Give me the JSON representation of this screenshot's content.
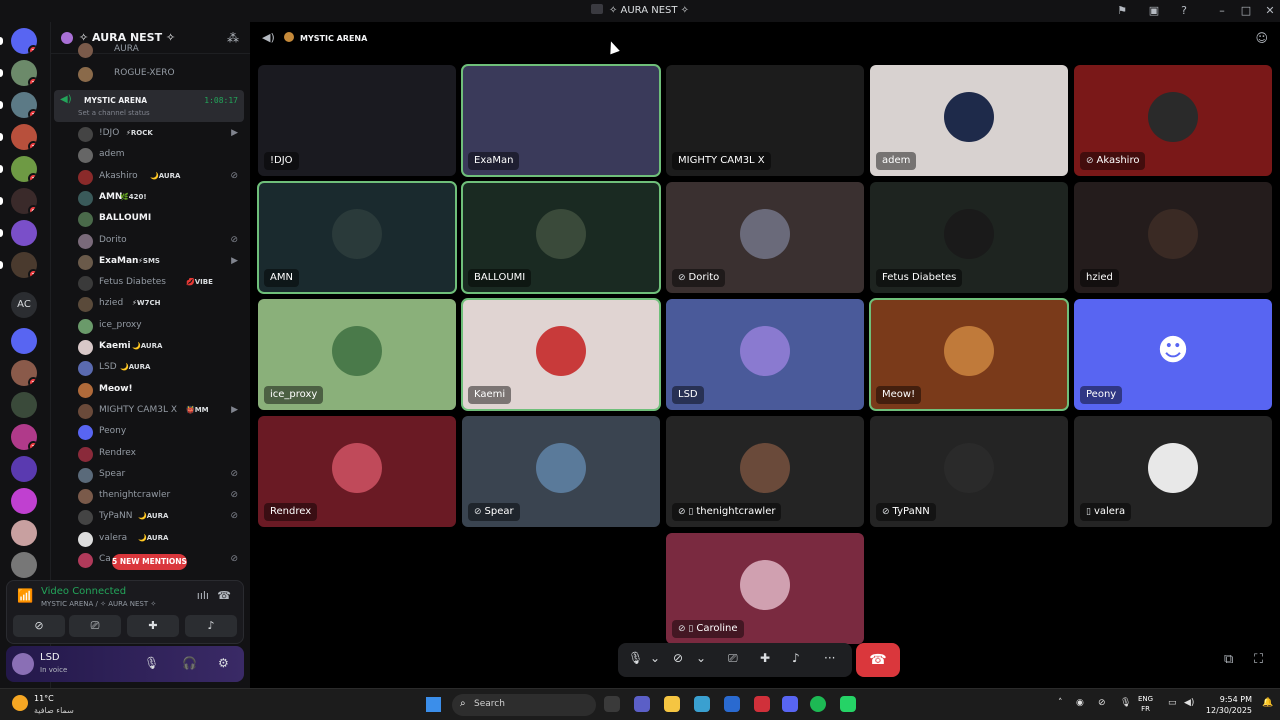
{
  "window": {
    "title": "✧ AURA NEST ✧"
  },
  "server": {
    "name": "✧ AURA NEST ✧"
  },
  "guilds": [
    {
      "badge": "2",
      "color": "#5865f2"
    },
    {
      "badge": "1",
      "color": "#6c8a6a"
    },
    {
      "badge": "1",
      "color": "#5c7a86"
    },
    {
      "badge": "1",
      "color": "#b8503c"
    },
    {
      "badge": "1",
      "color": "#6e9a44"
    },
    {
      "badge": "6",
      "color": "#3a2a2a"
    },
    {
      "badge": "",
      "color": "#7a4fc9"
    },
    {
      "badge": "1",
      "color": "#4a3a2e"
    },
    {
      "label": "AC",
      "color": "#2b2d31"
    },
    {
      "badge": "",
      "color": "#5865f2"
    },
    {
      "badge": "3",
      "color": "#8a5a4a"
    },
    {
      "badge": "",
      "color": "#3a4a3a"
    },
    {
      "badge": "3",
      "color": "#b03a8a"
    },
    {
      "badge": "",
      "color": "#5a3ab0"
    },
    {
      "badge": "",
      "color": "#c040d0"
    },
    {
      "badge": "",
      "color": "#c8a0a0"
    },
    {
      "badge": "",
      "color": "#777777"
    }
  ],
  "sidebar_top": [
    {
      "name": "AURA",
      "color": "#7a5a4a"
    },
    {
      "name": "ROGUE-XERO",
      "color": "#8a6a4a"
    }
  ],
  "channel": {
    "name": "MYSTIC ARENA",
    "timer": "1:08:17",
    "status": "Set a channel status"
  },
  "members": [
    {
      "name": "!DJO",
      "tag": "⚡ROCK",
      "bold": false,
      "color": "#444",
      "icon": "▶"
    },
    {
      "name": "adem",
      "tag": "",
      "bold": false,
      "color": "#666",
      "icon": ""
    },
    {
      "name": "Akashiro",
      "tag": "🌙AURA",
      "bold": false,
      "color": "#8a2a2a",
      "icon": "⊘"
    },
    {
      "name": "AMN",
      "tag": "🌿420!",
      "bold": true,
      "color": "#3a5a5a",
      "icon": ""
    },
    {
      "name": "BALLOUMI",
      "tag": "",
      "bold": true,
      "color": "#4a6a4a",
      "icon": ""
    },
    {
      "name": "Dorito",
      "tag": "",
      "bold": false,
      "color": "#7a6a7a",
      "icon": "⊘"
    },
    {
      "name": "ExaMan",
      "tag": "⚡SMS",
      "bold": true,
      "color": "#6a5a4a",
      "icon": "▶"
    },
    {
      "name": "Fetus Diabetes",
      "tag": "💋VIBE",
      "bold": false,
      "color": "#3a3a3a",
      "icon": ""
    },
    {
      "name": "hzied",
      "tag": "⚡W7CH",
      "bold": false,
      "color": "#5a4a3a",
      "icon": ""
    },
    {
      "name": "ice_proxy",
      "tag": "",
      "bold": false,
      "color": "#6a9a6a",
      "icon": ""
    },
    {
      "name": "Kaemi",
      "tag": "🌙AURA",
      "bold": true,
      "color": "#d8c8c8",
      "icon": ""
    },
    {
      "name": "LSD",
      "tag": "🌙AURA",
      "bold": false,
      "color": "#5a6ab0",
      "icon": ""
    },
    {
      "name": "Meow!",
      "tag": "",
      "bold": true,
      "color": "#b06a3a",
      "icon": ""
    },
    {
      "name": "MIGHTY CAM3L X",
      "tag": "👹MM",
      "bold": false,
      "color": "#6a4a3a",
      "icon": "▶"
    },
    {
      "name": "Peony",
      "tag": "",
      "bold": false,
      "color": "#5865f2",
      "icon": ""
    },
    {
      "name": "Rendrex",
      "tag": "",
      "bold": false,
      "color": "#8a2a3a",
      "icon": ""
    },
    {
      "name": "Spear",
      "tag": "",
      "bold": false,
      "color": "#5a6a7a",
      "icon": "⊘"
    },
    {
      "name": "thenightcrawler",
      "tag": "",
      "bold": false,
      "color": "#7a5a4a",
      "icon": "⊘"
    },
    {
      "name": "TyPaNN",
      "tag": "🌙AURA",
      "bold": false,
      "color": "#444",
      "icon": "⊘"
    },
    {
      "name": "valera",
      "tag": "🌙AURA",
      "bold": false,
      "color": "#ddd",
      "icon": ""
    },
    {
      "name": "Ca",
      "tag": "",
      "bold": false,
      "color": "#b03a5a",
      "icon": "⊘"
    }
  ],
  "new_mentions": "5 NEW MENTIONS",
  "voice": {
    "title": "Video Connected",
    "subtitle": "MYSTIC ARENA / ✧ AURA NEST ✧"
  },
  "user": {
    "name": "LSD",
    "status": "In voice"
  },
  "tiles": [
    {
      "name": "!DJO",
      "bg": "#1a1a20",
      "avatar": "",
      "speaking": false,
      "icons": ""
    },
    {
      "name": "ExaMan",
      "bg": "#3a3a5a",
      "avatar": "",
      "speaking": true,
      "icons": ""
    },
    {
      "name": "MIGHTY CAM3L X",
      "bg": "#1c1c1c",
      "avatar": "",
      "speaking": false,
      "icons": ""
    },
    {
      "name": "adem",
      "bg": "#d8d2d0",
      "avatar": "#1e2a4a",
      "speaking": false,
      "icons": ""
    },
    {
      "name": "Akashiro",
      "bg": "#7a1818",
      "avatar": "#2a2a2a",
      "speaking": false,
      "icons": "⊘"
    },
    {
      "name": "AMN",
      "bg": "#1a2a2e",
      "avatar": "#2a3a3a",
      "speaking": true,
      "icons": ""
    },
    {
      "name": "BALLOUMI",
      "bg": "#1a2a22",
      "avatar": "#3a4a3a",
      "speaking": true,
      "icons": ""
    },
    {
      "name": "Dorito",
      "bg": "#3a3030",
      "avatar": "#6a6a7a",
      "speaking": false,
      "icons": "⊘"
    },
    {
      "name": "Fetus Diabetes",
      "bg": "#1e2420",
      "avatar": "#1a1a1a",
      "speaking": false,
      "icons": ""
    },
    {
      "name": "hzied",
      "bg": "#241c1c",
      "avatar": "#3a2a24",
      "speaking": false,
      "icons": ""
    },
    {
      "name": "ice_proxy",
      "bg": "#8ab07a",
      "avatar": "#4a7a4a",
      "speaking": false,
      "icons": ""
    },
    {
      "name": "Kaemi",
      "bg": "#e0d4d2",
      "avatar": "#c83a3a",
      "speaking": true,
      "icons": ""
    },
    {
      "name": "LSD",
      "bg": "#4a5a9a",
      "avatar": "#8a7ad0",
      "speaking": false,
      "icons": ""
    },
    {
      "name": "Meow!",
      "bg": "#7a3a1a",
      "avatar": "#c07a3a",
      "speaking": true,
      "icons": ""
    },
    {
      "name": "Peony",
      "bg": "#5865f2",
      "avatar": "",
      "speaking": false,
      "icons": ""
    },
    {
      "name": "Rendrex",
      "bg": "#6a1a24",
      "avatar": "#c04a5a",
      "speaking": false,
      "icons": ""
    },
    {
      "name": "Spear",
      "bg": "#3a4450",
      "avatar": "#5a7a9a",
      "speaking": false,
      "icons": "⊘"
    },
    {
      "name": "thenightcrawler",
      "bg": "#242424",
      "avatar": "#6a4a3a",
      "speaking": false,
      "icons": "⊘ ▯"
    },
    {
      "name": "TyPaNN",
      "bg": "#242424",
      "avatar": "#2a2a2a",
      "speaking": false,
      "icons": "⊘"
    },
    {
      "name": "valera",
      "bg": "#242424",
      "avatar": "#e8e8e8",
      "speaking": false,
      "icons": "▯"
    },
    {
      "name": "Caroline",
      "bg": "#7a2a40",
      "avatar": "#d0a0b0",
      "speaking": false,
      "icons": "⊘ ▯"
    }
  ],
  "taskbar": {
    "weather_temp": "11°C",
    "weather_cond": "سماء صافية",
    "weather_badge": "4",
    "search": "Search",
    "lang1": "ENG",
    "lang2": "FR",
    "time": "9:54 PM",
    "date": "12/30/2025"
  }
}
